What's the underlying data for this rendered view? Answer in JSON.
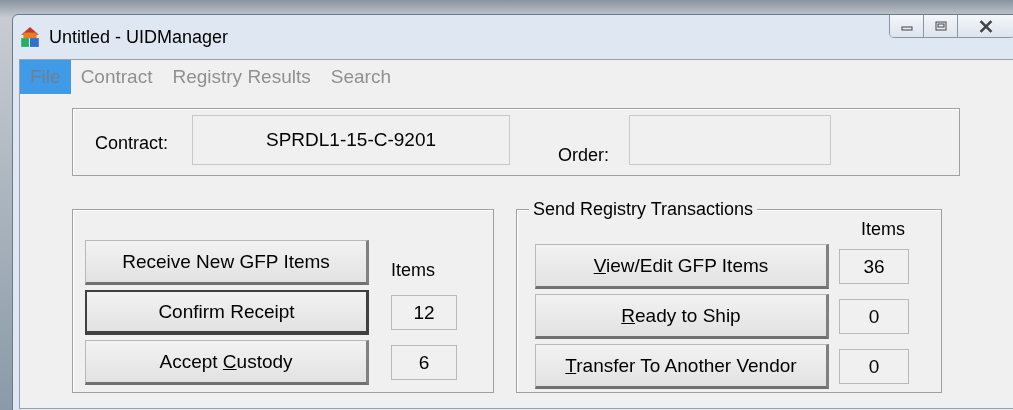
{
  "window": {
    "title": "Untitled - UIDManager"
  },
  "menu": [
    {
      "label": "File",
      "selected": true
    },
    {
      "label": "Contract",
      "selected": false
    },
    {
      "label": "Registry Results",
      "selected": false
    },
    {
      "label": "Search",
      "selected": false
    }
  ],
  "contract": {
    "label": "Contract:",
    "value": "SPRDL1-15-C-9201",
    "order_label": "Order:"
  },
  "receive_group": {
    "items_label": "Items",
    "buttons": [
      {
        "pre": "Receive New GFP Items",
        "default": false
      },
      {
        "pre": "Confirm Receipt",
        "default": true,
        "count": "12"
      },
      {
        "pre": "Accept ",
        "key": "C",
        "post": "ustody",
        "default": false,
        "count": "6"
      }
    ]
  },
  "send_group": {
    "title": "Send Registry Transactions",
    "items_label": "Items",
    "buttons": [
      {
        "key": "V",
        "post": "iew/Edit GFP Items",
        "default": false,
        "count": "36"
      },
      {
        "key": "R",
        "post": "eady to Ship",
        "default": false,
        "count": "0"
      },
      {
        "key": "T",
        "post": "ransfer To Another Vendor",
        "default": false,
        "count": "0"
      }
    ]
  }
}
